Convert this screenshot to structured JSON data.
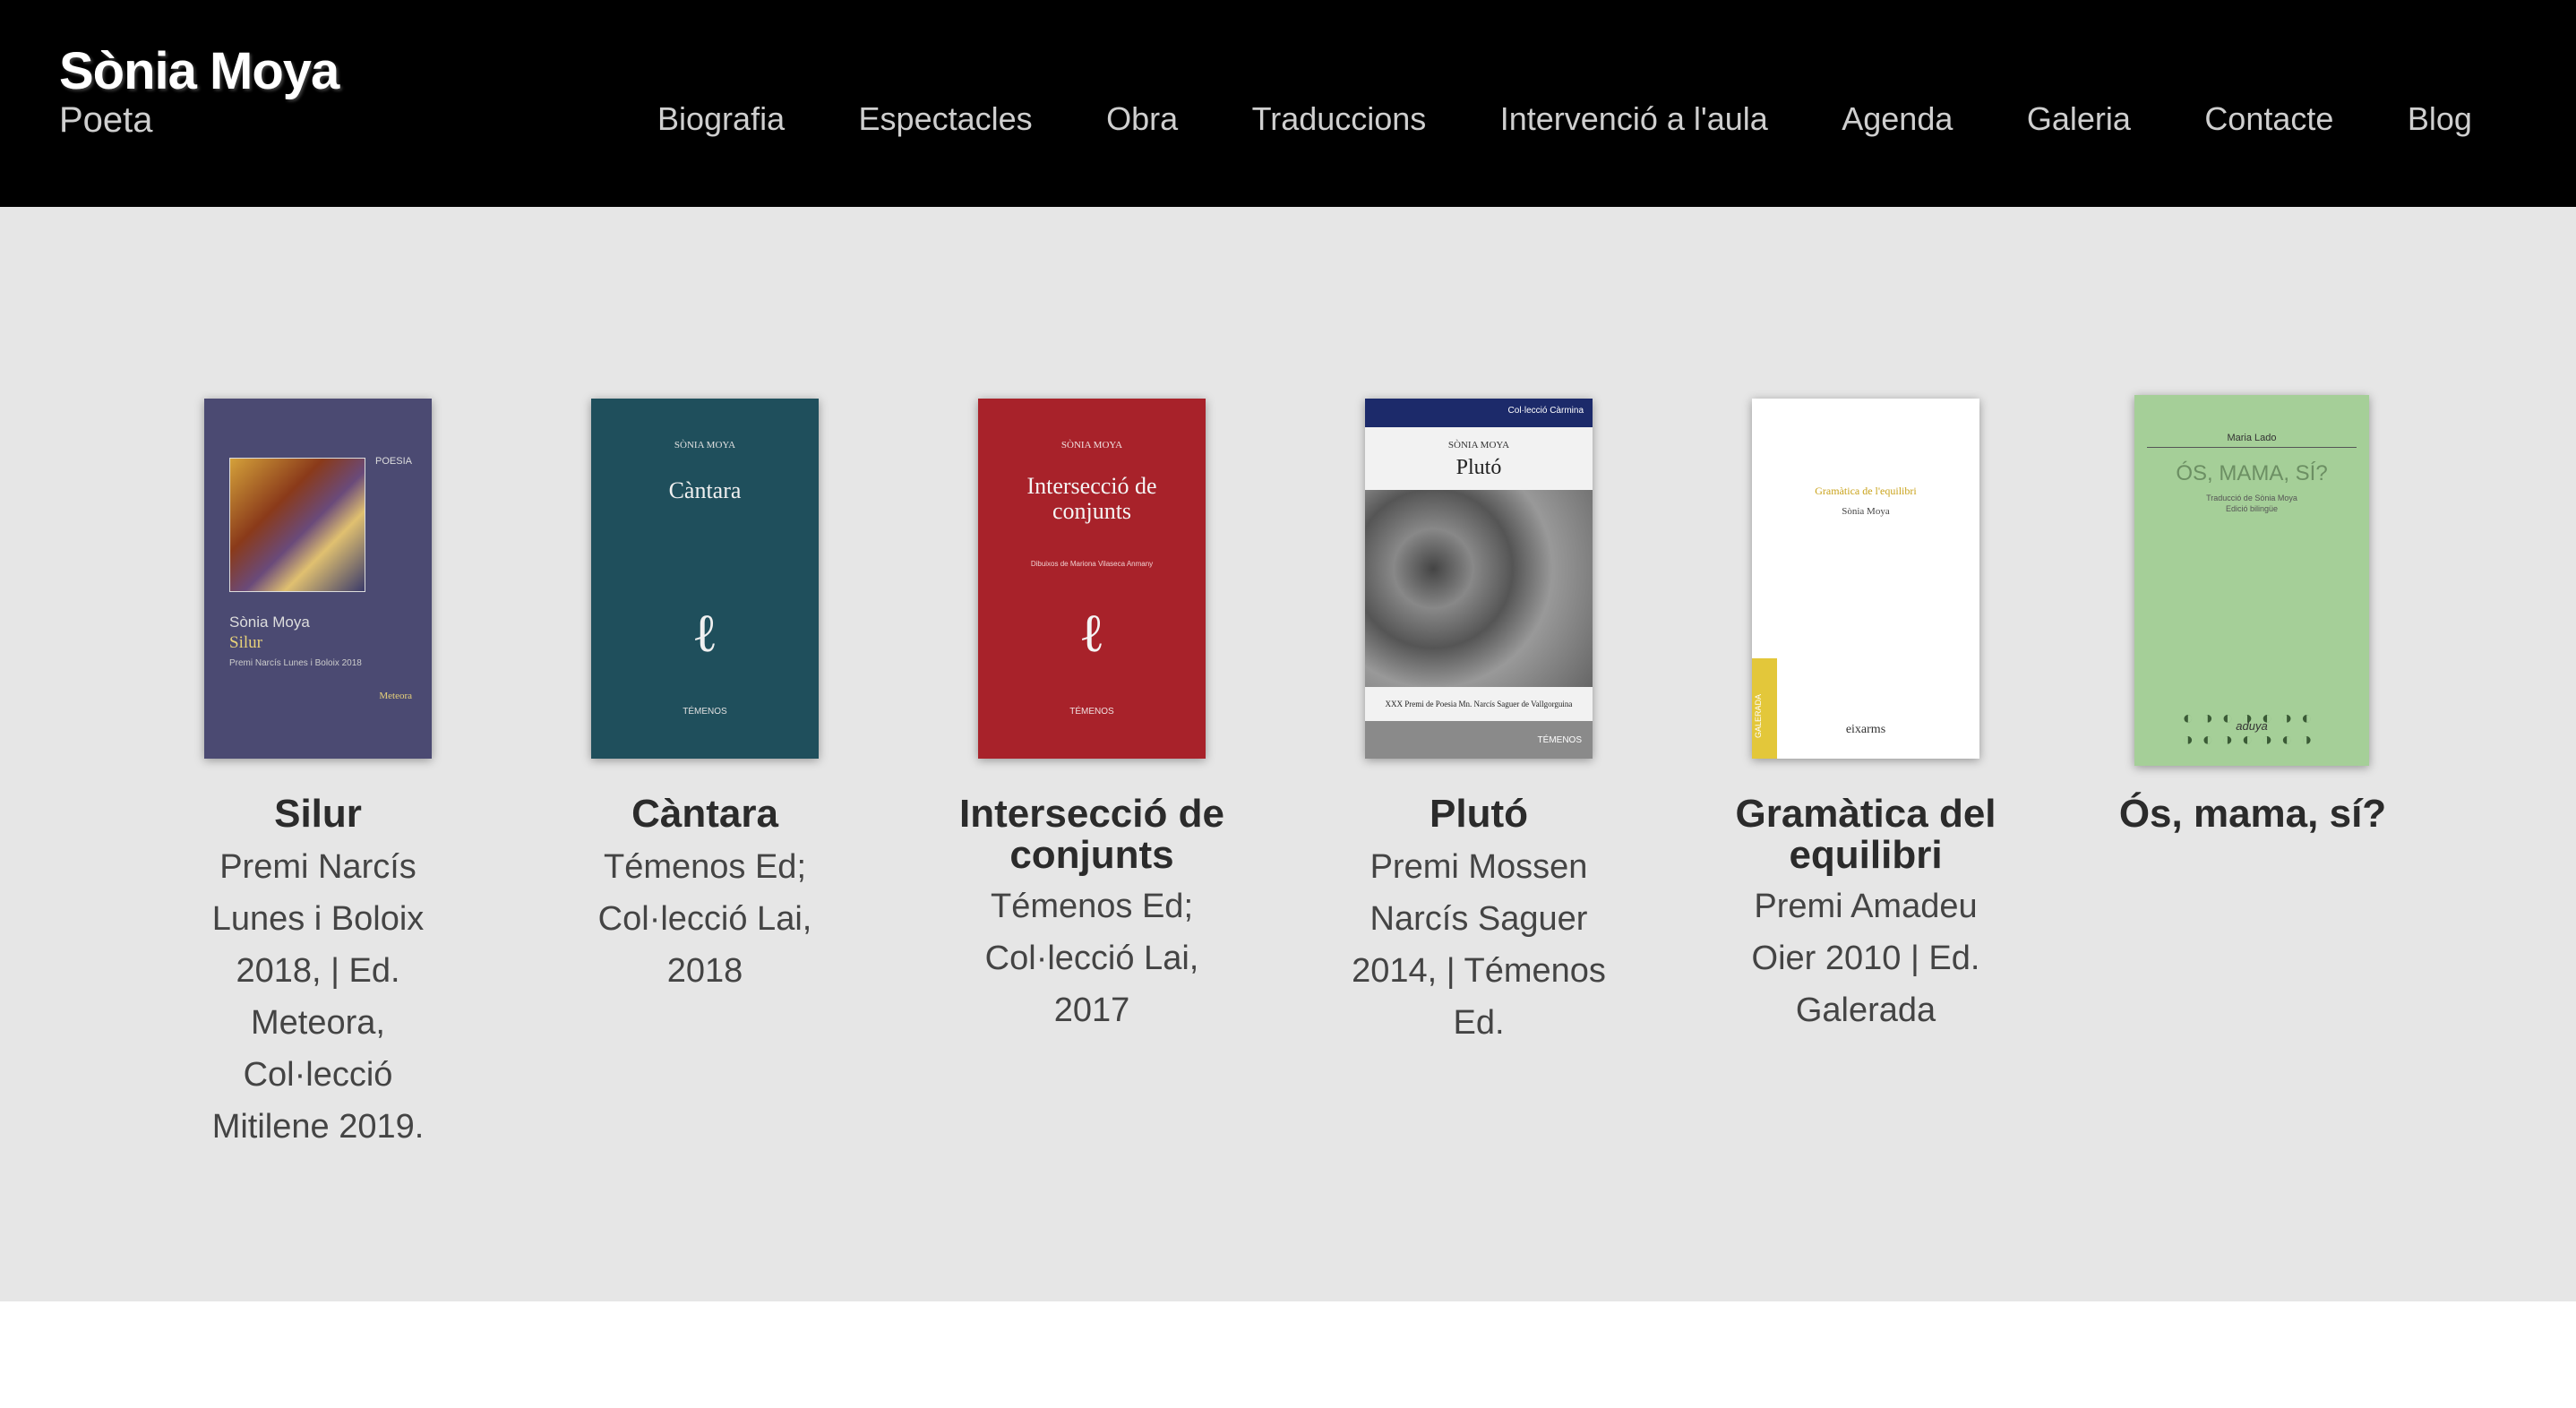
{
  "header": {
    "name": "Sònia Moya",
    "subtitle": "Poeta",
    "nav": [
      "Biografia",
      "Espectacles",
      "Obra",
      "Traduccions",
      "Intervenció a l'aula",
      "Agenda",
      "Galeria",
      "Contacte",
      "Blog"
    ]
  },
  "books": [
    {
      "title": "Silur",
      "desc": "Premi Narcís Lunes i Boloix 2018, | Ed. Meteora, Col·lecció Mitilene 2019.",
      "cover": {
        "bg": "#4b4a72",
        "series": "POESIA",
        "author": "Sònia Moya",
        "title": "Silur",
        "note": "Premi Narcís Lunes i Boloix 2018",
        "publisher": "Meteora"
      }
    },
    {
      "title": "Càntara",
      "desc": "Témenos Ed; Col·lecció Lai, 2018",
      "cover": {
        "bg": "#1f4f5c",
        "author": "SÒNIA MOYA",
        "title": "Càntara",
        "publisher": "TÉMENOS"
      }
    },
    {
      "title": "Intersecció de conjunts",
      "desc": "Témenos Ed; Col·lecció Lai, 2017",
      "cover": {
        "bg": "#a8222a",
        "author": "SÒNIA MOYA",
        "title": "Intersecció de conjunts",
        "note": "Dibuixos de Mariona Vilaseca Anmany",
        "publisher": "TÉMENOS"
      }
    },
    {
      "title": "Plutó",
      "desc": "Premi Mossen Narcís Saguer 2014, | Témenos Ed.",
      "cover": {
        "bg": "#f2f2f2",
        "collection": "Col·lecció Càrmina",
        "author": "SÒNIA MOYA",
        "title": "Plutó",
        "note": "XXX Premi de Poesia Mn. Narcís Saguer de Vallgorguina",
        "publisher": "TÉMENOS"
      }
    },
    {
      "title": "Gramàtica del equilibri",
      "desc": "Premi Amadeu Oier 2010 | Ed. Galerada",
      "cover": {
        "bg": "#ffffff",
        "title": "Gramàtica de l'equilibri",
        "author": "Sònia Moya",
        "spine": "GALERADA",
        "publisher": "eixarms"
      }
    },
    {
      "title": "Ós, mama, sí?",
      "desc": "",
      "cover": {
        "bg": "#a5cf98",
        "author": "Maria Lado",
        "title": "ÓS, MAMA, SÍ?",
        "note": "Traducció de Sònia Moya",
        "note2": "Edició bilingüe",
        "publisher": "aduya"
      }
    }
  ]
}
